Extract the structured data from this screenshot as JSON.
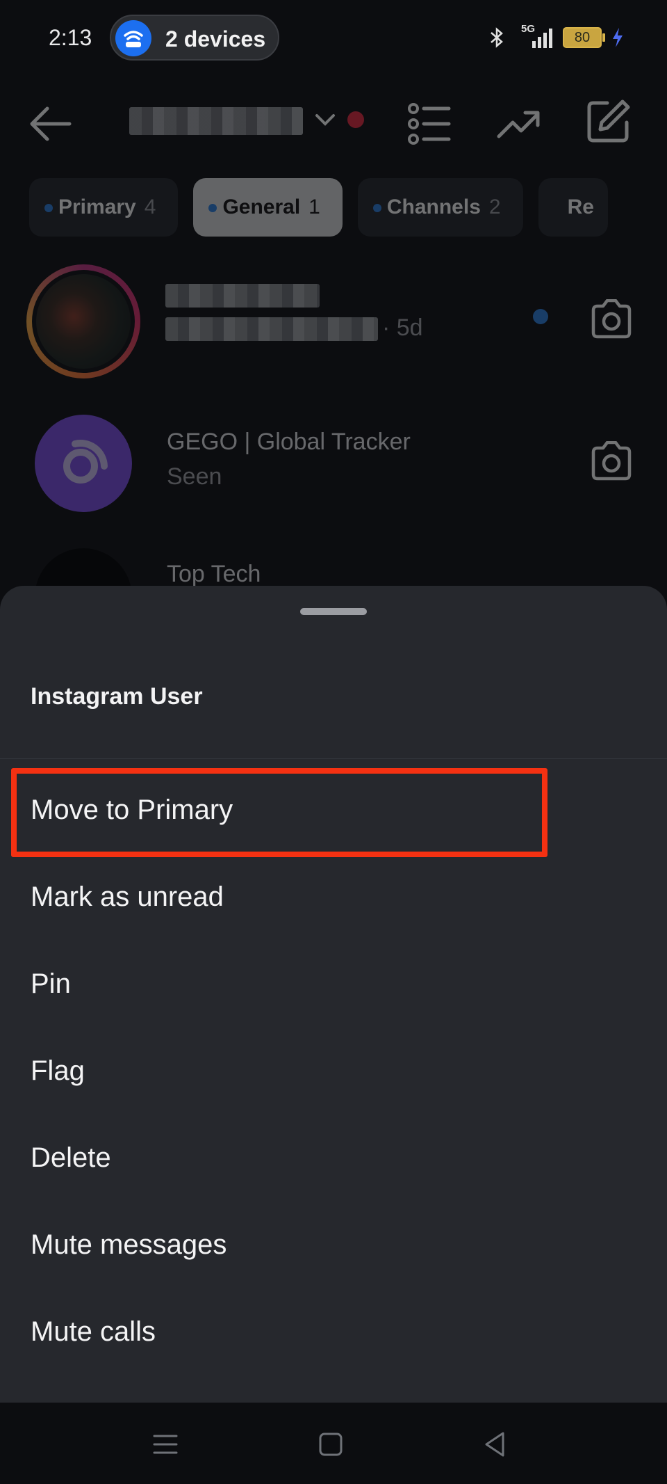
{
  "status_bar": {
    "time": "2:13",
    "devices_label": "2 devices",
    "network": "5G",
    "battery": "80"
  },
  "header": {
    "icons": [
      "back-arrow-icon",
      "chevron-down-icon",
      "list-icon",
      "trending-icon",
      "compose-icon"
    ]
  },
  "tabs": [
    {
      "label": "Primary",
      "count": "4",
      "active": false
    },
    {
      "label": "General",
      "count": "1",
      "active": true
    },
    {
      "label": "Channels",
      "count": "2",
      "active": false
    },
    {
      "label": "Re",
      "count": "",
      "active": false
    }
  ],
  "conversations": [
    {
      "title": "",
      "subtitle": "· 5d",
      "unread": true
    },
    {
      "title": "GEGO | Global Tracker",
      "subtitle": "Seen",
      "unread": false
    },
    {
      "title": "Top Tech",
      "subtitle": "",
      "unread": false
    }
  ],
  "sheet": {
    "title": "Instagram User",
    "items": [
      {
        "label": "Move to Primary",
        "highlighted": true
      },
      {
        "label": "Mark as unread"
      },
      {
        "label": "Pin"
      },
      {
        "label": "Flag"
      },
      {
        "label": "Delete"
      },
      {
        "label": "Mute messages"
      },
      {
        "label": "Mute calls"
      }
    ]
  },
  "colors": {
    "accent_blue": "#2b7fe0",
    "highlight_red": "#f43112",
    "sheet_bg": "#26282d",
    "unread_dot_red": "#e5283f"
  }
}
